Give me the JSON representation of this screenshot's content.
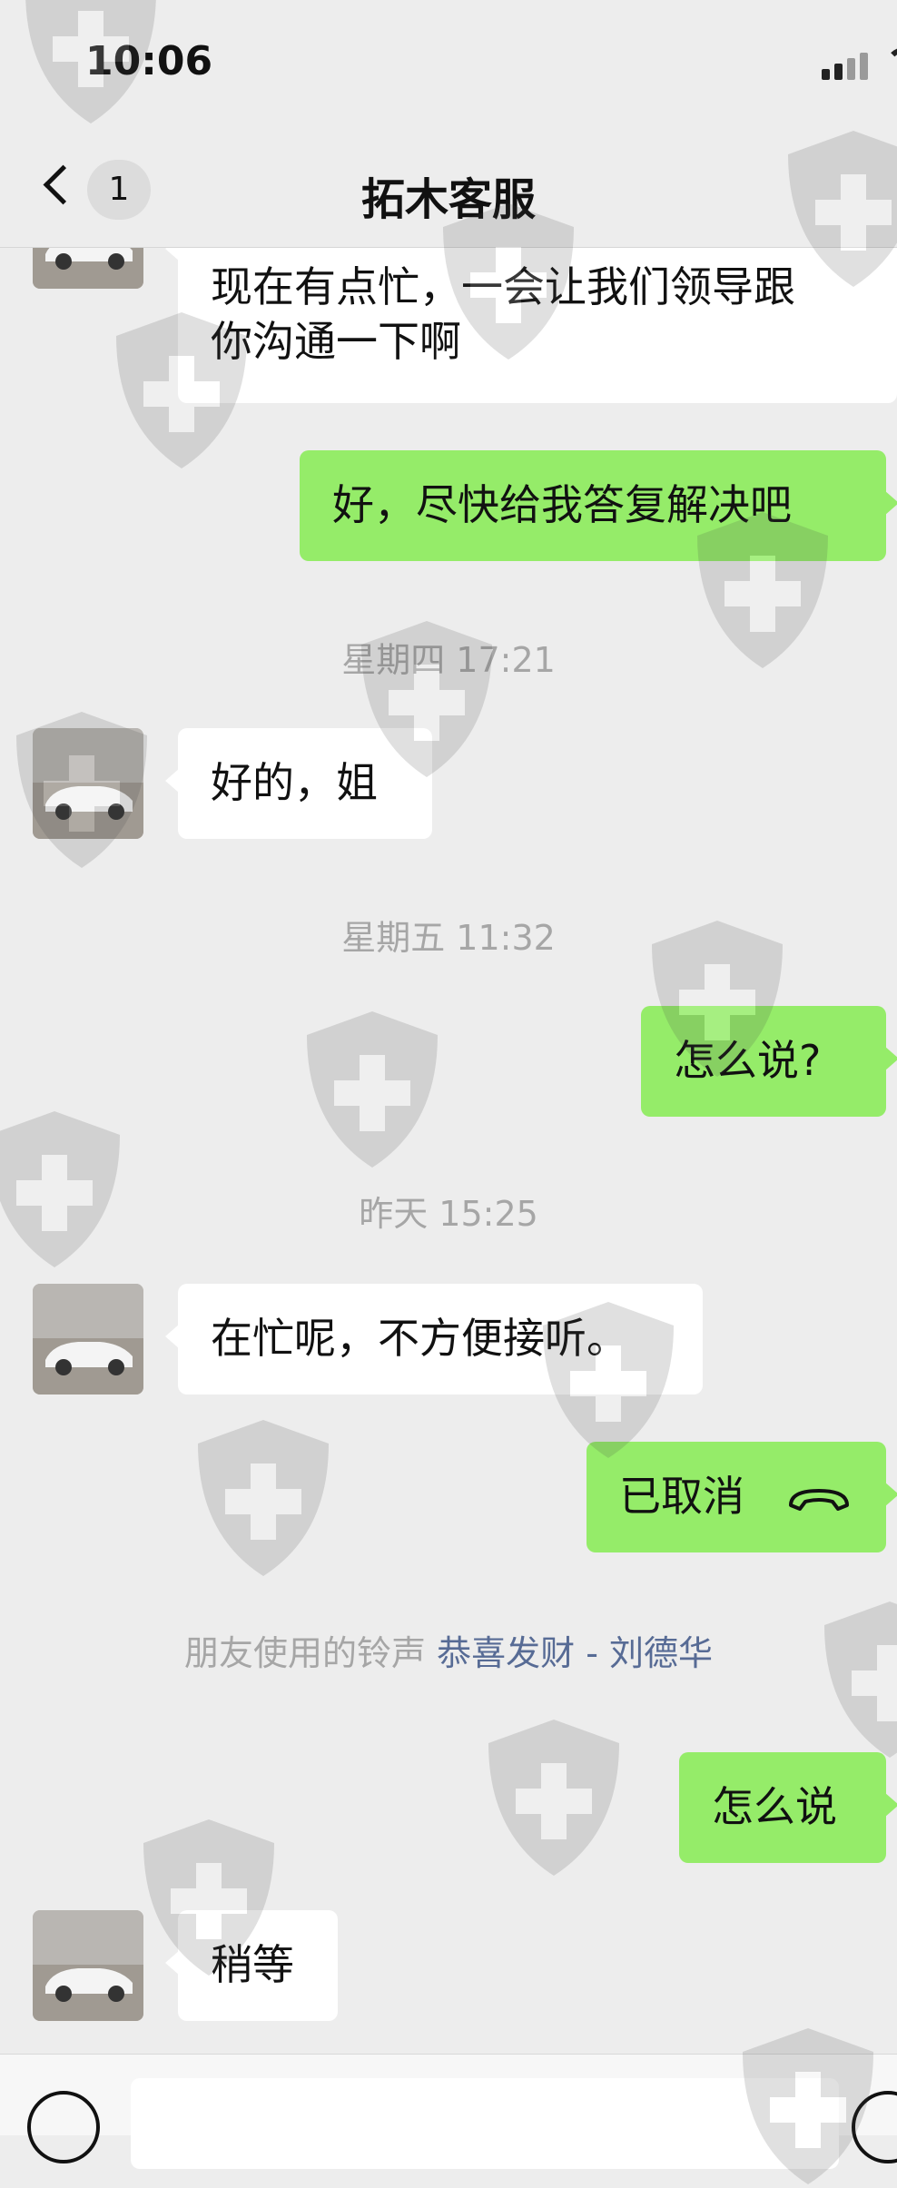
{
  "status_bar": {
    "time": "10:06"
  },
  "nav": {
    "back_badge": "1",
    "title": "拓木客服"
  },
  "messages": {
    "m0": {
      "line1": "现在有点忙，一会让我们领导跟",
      "line2": "你沟通一下啊"
    },
    "m1": {
      "text": "好，尽快给我答复解决吧"
    },
    "ts1": "星期四 17:21",
    "m2": {
      "text": "好的，姐"
    },
    "ts2": "星期五 11:32",
    "m3": {
      "text": "怎么说?"
    },
    "ts3": "昨天 15:25",
    "m4": {
      "text": "在忙呢，不方便接听。"
    },
    "m5": {
      "text": "已取消"
    },
    "ringtone": {
      "prefix": "朋友使用的铃声",
      "song": "恭喜发财 - 刘德华"
    },
    "m6": {
      "text": "怎么说"
    },
    "m7": {
      "text": "稍等"
    }
  },
  "icons": {
    "back": "chevron-left-icon",
    "call": "phone-hangup-icon",
    "voice": "voice-icon",
    "emoji": "emoji-icon",
    "watermark": "shield-cross-icon"
  },
  "colors": {
    "background": "#ededed",
    "outgoing_bubble": "#95ec69",
    "incoming_bubble": "#ffffff",
    "timestamp": "#a6a6a6",
    "link": "#576b95"
  }
}
